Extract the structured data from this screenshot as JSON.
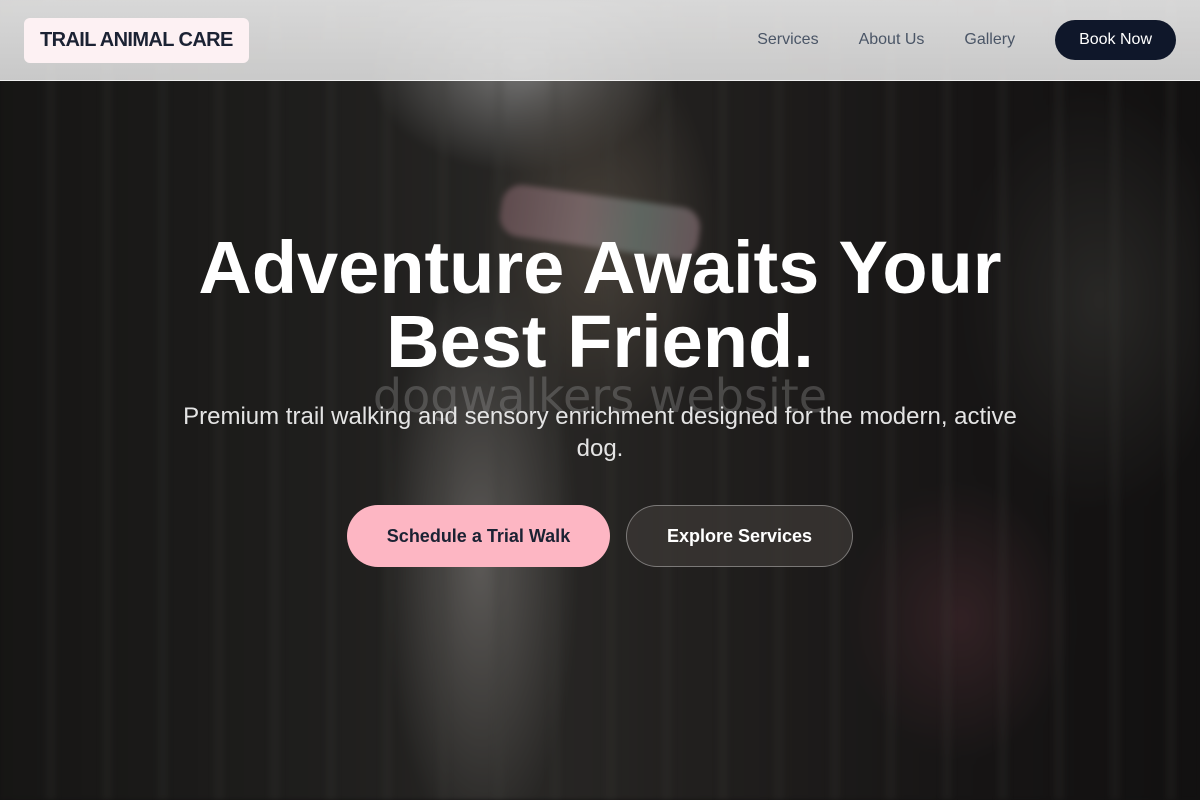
{
  "header": {
    "logo_text": "TRAIL ANIMAL CARE",
    "nav": [
      {
        "label": "Services"
      },
      {
        "label": "About Us"
      },
      {
        "label": "Gallery"
      }
    ],
    "book_label": "Book Now"
  },
  "hero": {
    "watermark": "dogwalkers website",
    "headline_line1": "Adventure Awaits Your",
    "headline_line2": "Best Friend.",
    "subheadline": "Premium trail walking and sensory enrichment designed for the modern, active dog.",
    "primary_cta": "Schedule a Trial Walk",
    "secondary_cta": "Explore Services"
  },
  "colors": {
    "accent_pink": "#fdb6c3",
    "navy": "#0f172a"
  }
}
